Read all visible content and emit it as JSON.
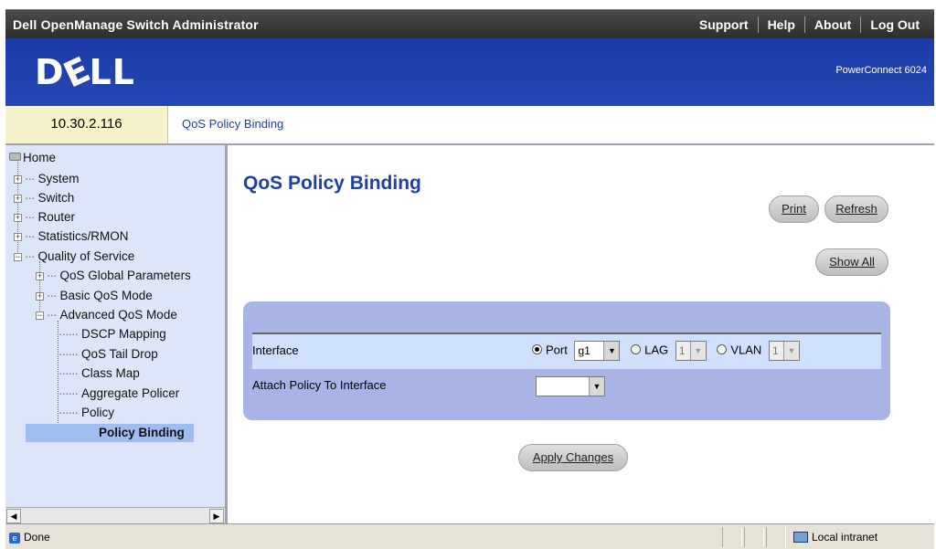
{
  "titlebar": {
    "app_title": "Dell OpenManage Switch Administrator",
    "links": [
      "Support",
      "Help",
      "About",
      "Log Out"
    ]
  },
  "banner": {
    "logo": "DELL",
    "product": "PowerConnect 6024"
  },
  "address": {
    "ip": "10.30.2.116",
    "breadcrumb": "QoS Policy Binding"
  },
  "tree": {
    "home": "Home",
    "system": "System",
    "switch": "Switch",
    "router": "Router",
    "statistics": "Statistics/RMON",
    "qos": "Quality of Service",
    "qos_global": "QoS Global Parameters",
    "basic_qos": "Basic QoS Mode",
    "advanced_qos": "Advanced QoS Mode",
    "dscp": "DSCP Mapping",
    "tail_drop": "QoS Tail Drop",
    "class_map": "Class Map",
    "aggregate": "Aggregate Policer",
    "policy": "Policy",
    "policy_binding": "Policy Binding"
  },
  "main": {
    "title": "QoS Policy Binding",
    "buttons": {
      "print": "Print",
      "refresh": "Refresh",
      "show_all": "Show All",
      "apply": "Apply Changes"
    },
    "form": {
      "interface_label": "Interface",
      "attach_label": "Attach Policy To Interface",
      "port_label": "Port",
      "port_value": "g1",
      "lag_label": "LAG",
      "lag_value": "1",
      "vlan_label": "VLAN",
      "vlan_value": "1",
      "attach_value": ""
    }
  },
  "status": {
    "text": "Done",
    "zone": "Local intranet"
  }
}
